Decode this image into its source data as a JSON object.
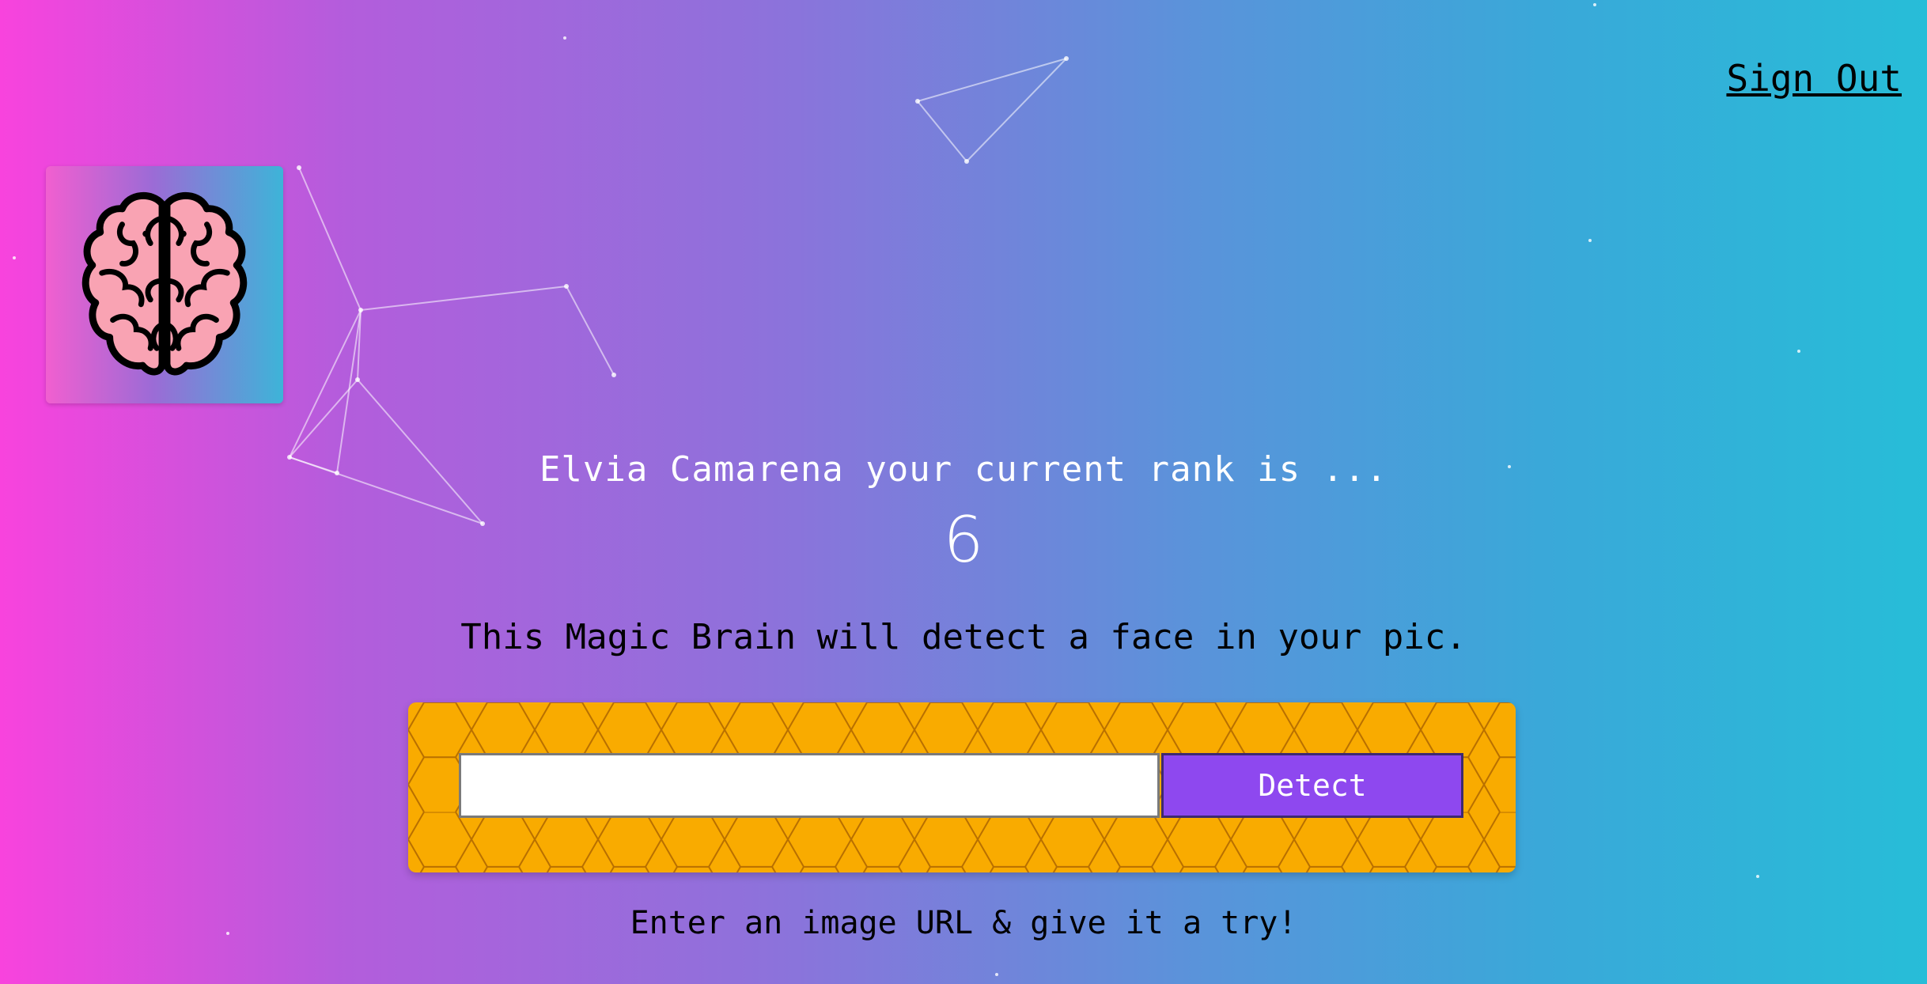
{
  "header": {
    "sign_out_label": "Sign Out"
  },
  "logo": {
    "icon": "brain-icon",
    "colors": {
      "fill": "#f9a3b3",
      "stroke": "#000000"
    }
  },
  "rank": {
    "message": "Elvia Camarena your current rank is ...",
    "value": "6"
  },
  "main": {
    "tagline": "This Magic Brain will detect a face in your pic.",
    "input": {
      "value": "",
      "placeholder": ""
    },
    "detect_label": "Detect",
    "hint": "Enter an image URL & give it a try!"
  },
  "colors": {
    "background_start": "#f843dd",
    "background_end": "#27bdd8",
    "panel": "#f9ab00",
    "hex_lines": "#b86f00",
    "button": "#8e48ef"
  }
}
